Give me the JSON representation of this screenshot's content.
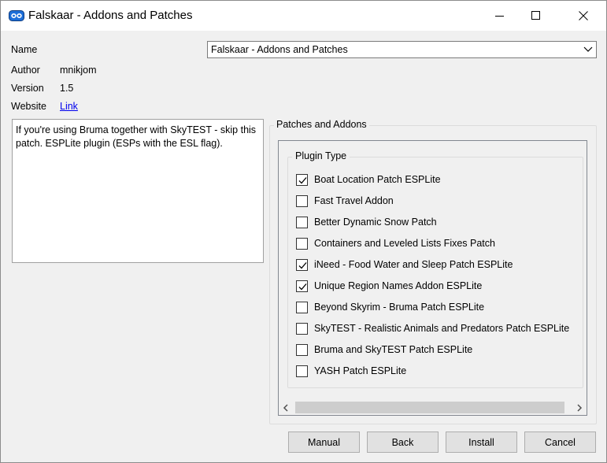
{
  "window": {
    "title": "Falskaar - Addons and Patches",
    "app_icon": "mod-organizer-icon",
    "controls": [
      "minimize-icon",
      "maximize-icon",
      "close-icon"
    ]
  },
  "info": {
    "name_label": "Name",
    "name_value": "Falskaar - Addons and Patches",
    "author_label": "Author",
    "author_value": "mnikjom",
    "version_label": "Version",
    "version_value": "1.5",
    "website_label": "Website",
    "website_link": "Link"
  },
  "description": "If you're using Bruma together with SkyTEST - skip this patch. ESPLite plugin (ESPs with the ESL flag).",
  "patches": {
    "group_title": "Patches and Addons",
    "plugin_type_title": "Plugin Type",
    "items": [
      {
        "label": "Boat Location Patch ESPLite",
        "checked": true
      },
      {
        "label": "Fast Travel Addon",
        "checked": false
      },
      {
        "label": "Better Dynamic Snow Patch",
        "checked": false
      },
      {
        "label": "Containers and Leveled Lists Fixes Patch",
        "checked": false
      },
      {
        "label": "iNeed - Food Water and Sleep Patch ESPLite",
        "checked": true
      },
      {
        "label": "Unique Region Names Addon ESPLite",
        "checked": true
      },
      {
        "label": "Beyond Skyrim - Bruma Patch ESPLite",
        "checked": false
      },
      {
        "label": "SkyTEST - Realistic Animals and Predators Patch ESPLite",
        "checked": false
      },
      {
        "label": "Bruma and SkyTEST Patch ESPLite",
        "checked": false
      },
      {
        "label": "YASH Patch ESPLite",
        "checked": false
      }
    ]
  },
  "buttons": {
    "manual": "Manual",
    "back": "Back",
    "install": "Install",
    "cancel": "Cancel"
  }
}
